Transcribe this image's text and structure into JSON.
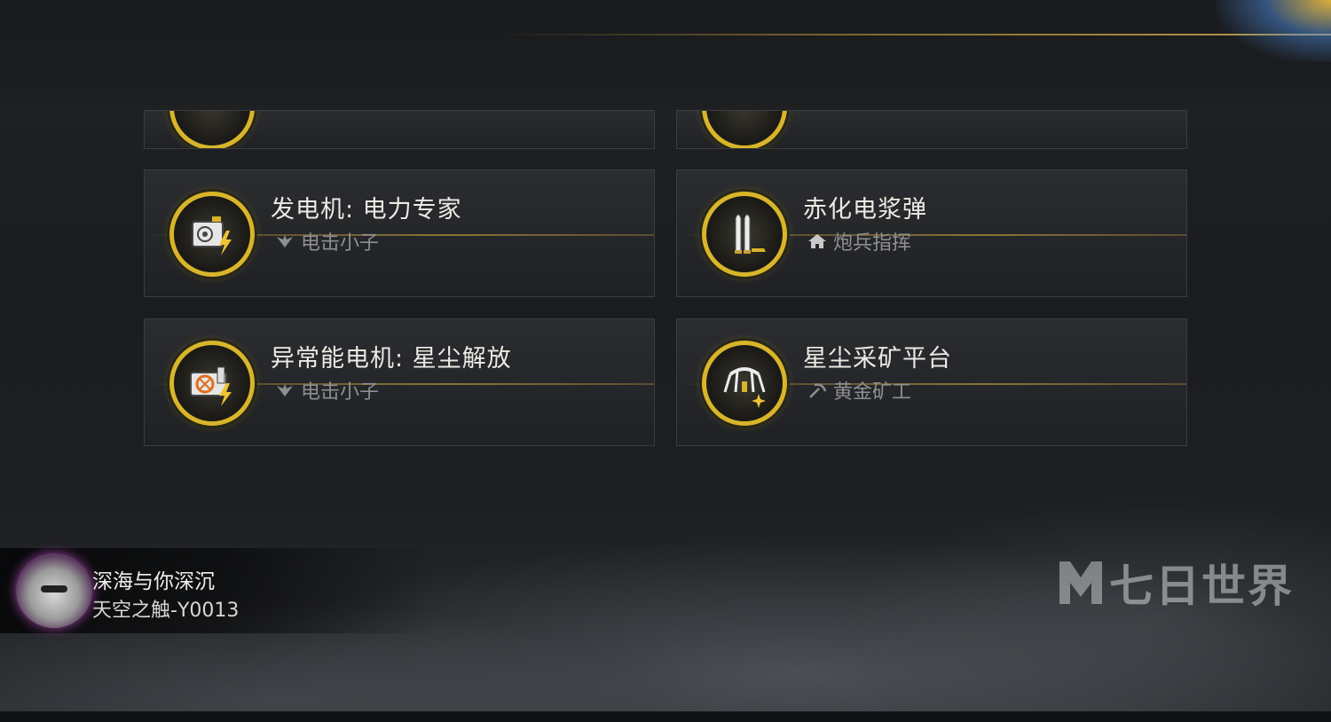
{
  "cards": [
    {
      "title": "",
      "subtitle": "",
      "icon": "partial-icon-left"
    },
    {
      "title": "",
      "subtitle": "",
      "icon": "partial-icon-right"
    },
    {
      "title": "发电机: 电力专家",
      "subtitle": "电击小子",
      "icon": "generator-icon",
      "sub_icon": "leaf-icon"
    },
    {
      "title": "赤化电浆弹",
      "subtitle": "炮兵指挥",
      "icon": "bullets-icon",
      "sub_icon": "house-icon"
    },
    {
      "title": "异常能电机: 星尘解放",
      "subtitle": "电击小子",
      "icon": "anomaly-generator-icon",
      "sub_icon": "leaf-icon"
    },
    {
      "title": "星尘采矿平台",
      "subtitle": "黄金矿工",
      "icon": "mining-platform-icon",
      "sub_icon": "pickaxe-icon"
    }
  ],
  "player": {
    "name": "深海与你深沉",
    "server": "天空之触-Y0013"
  },
  "watermark": {
    "text": "七日世界"
  },
  "colors": {
    "gold": "#d8b52a",
    "text": "#eceae4",
    "subtext": "#8e8f91"
  }
}
